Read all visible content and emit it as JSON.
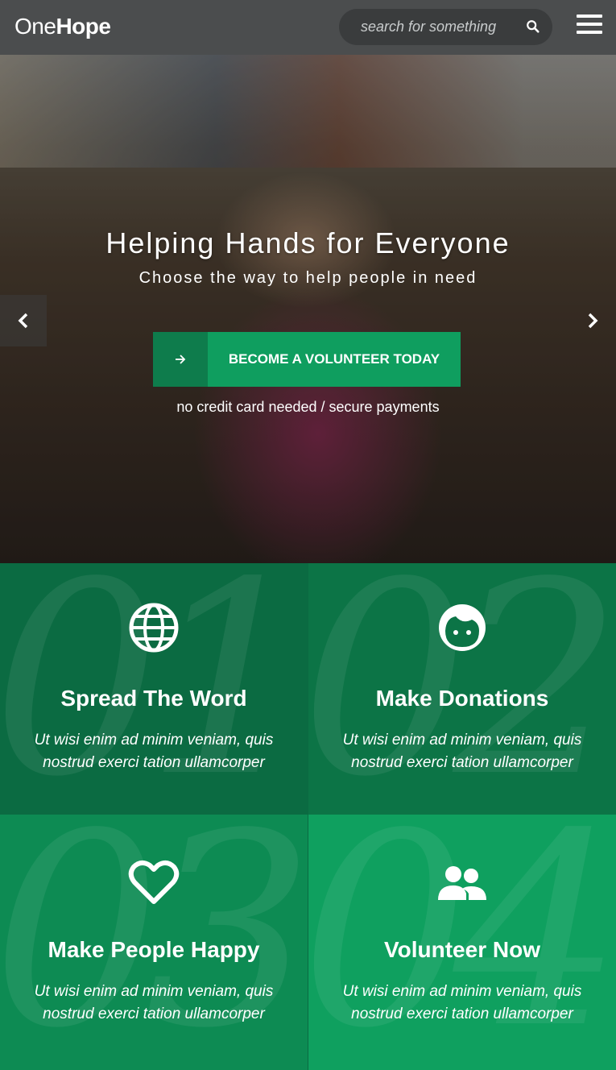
{
  "header": {
    "logo_part1": "One",
    "logo_part2": "Hope",
    "search_placeholder": "search for something",
    "search_icon": "search-icon",
    "menu_icon": "hamburger-menu-icon"
  },
  "hero": {
    "title": "Helping Hands for Everyone",
    "subtitle": "Choose the way to help people in need",
    "cta_label": "BECOME A VOLUNTEER TODAY",
    "cta_icon": "arrow-right-icon",
    "note": "no credit card needed / secure payments",
    "prev_icon": "chevron-left-icon",
    "next_icon": "chevron-right-icon"
  },
  "features": [
    {
      "number": "01",
      "icon": "globe-icon",
      "title": "Spread The Word",
      "text": "Ut wisi enim ad minim veniam, quis nostrud exerci tation ullamcorper"
    },
    {
      "number": "02",
      "icon": "face-icon",
      "title": "Make Donations",
      "text": "Ut wisi enim ad minim veniam, quis nostrud exerci tation ullamcorper"
    },
    {
      "number": "03",
      "icon": "heart-icon",
      "title": "Make People Happy",
      "text": "Ut wisi enim ad minim veniam, quis nostrud exerci tation ullamcorper"
    },
    {
      "number": "04",
      "icon": "users-icon",
      "title": "Volunteer Now",
      "text": "Ut wisi enim ad minim veniam, quis nostrud exerci tation ullamcorper"
    }
  ],
  "colors": {
    "header_bg": "#4b4d4e",
    "accent_green": "#0f9e5f",
    "dark_green": "#0b6b42"
  }
}
